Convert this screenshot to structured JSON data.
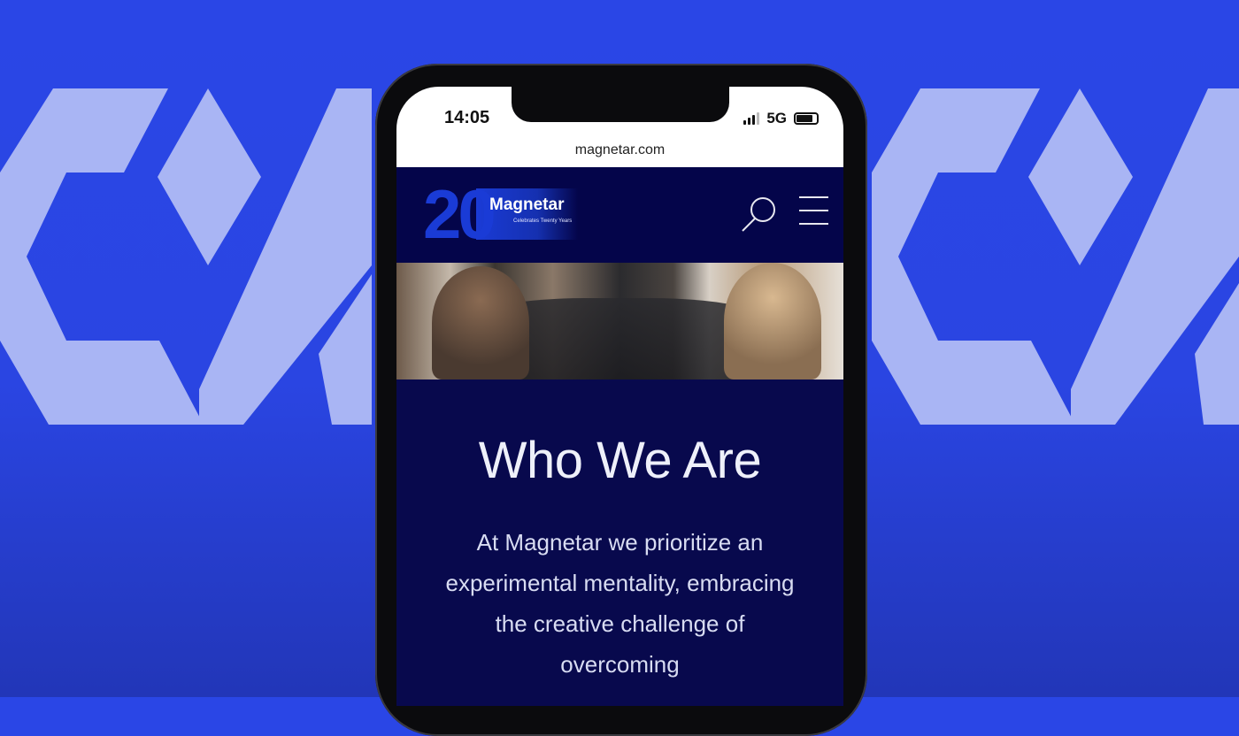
{
  "status_bar": {
    "time": "14:05",
    "network": "5G"
  },
  "browser": {
    "url": "magnetar.com"
  },
  "site": {
    "logo": {
      "number": "20",
      "name": "Magnetar",
      "tagline": "Celebrates Twenty Years"
    },
    "heading": "Who We Are",
    "intro": "At Magnetar we prioritize an experimental mentality, embracing the creative challenge of overcoming"
  },
  "colors": {
    "background": "#2a46e6",
    "site_navy": "#08094d",
    "accent": "#1a3bd6"
  }
}
